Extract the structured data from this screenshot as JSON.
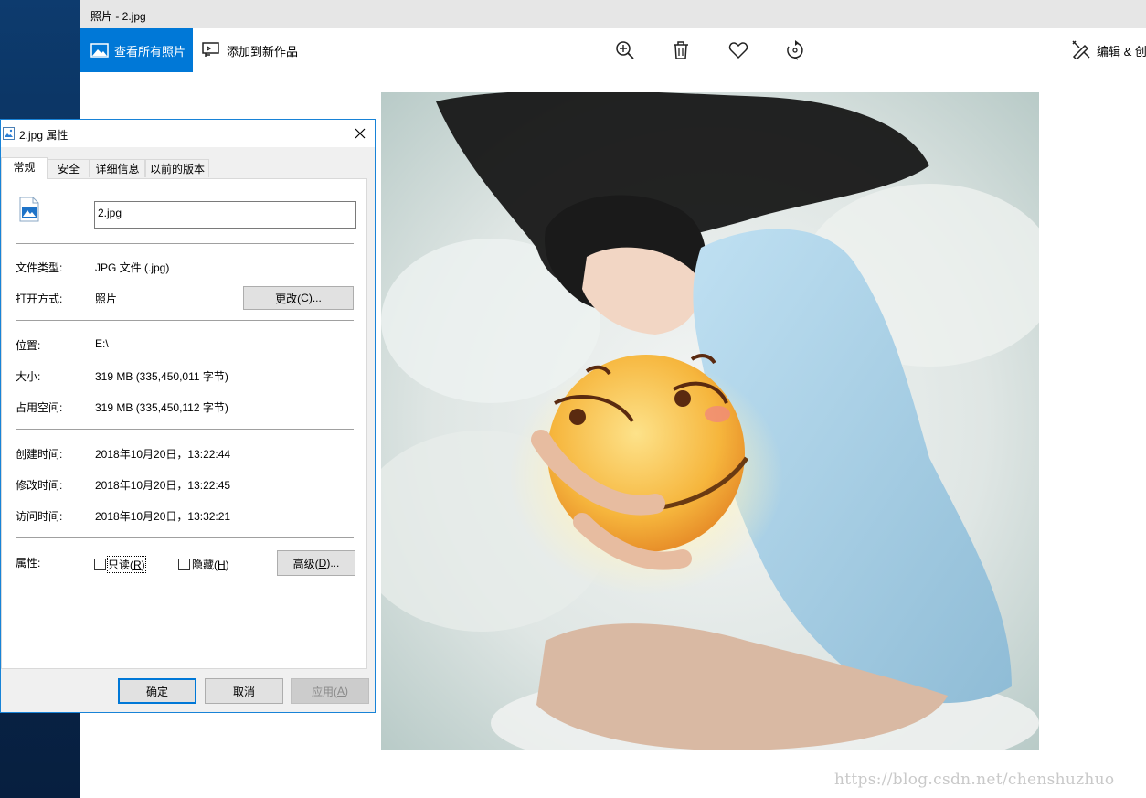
{
  "app": {
    "window_title": "照片 - 2.jpg",
    "toolbar": {
      "view_all_label": "查看所有照片",
      "add_to_creation_label": "添加到新作品",
      "edit_create_label": "编辑 & 创"
    },
    "watermark": "https://blog.csdn.net/chenshuzhuo"
  },
  "dialog": {
    "title": "2.jpg 属性",
    "tabs": [
      "常规",
      "安全",
      "详细信息",
      "以前的版本"
    ],
    "file_name": "2.jpg",
    "rows": {
      "file_type": {
        "label": "文件类型:",
        "value": "JPG 文件 (.jpg)"
      },
      "open_with": {
        "label": "打开方式:",
        "value": "照片"
      },
      "location": {
        "label": "位置:",
        "value": "E:\\"
      },
      "size": {
        "label": "大小:",
        "value": "319 MB (335,450,011 字节)"
      },
      "size_on_disk": {
        "label": "占用空间:",
        "value": "319 MB (335,450,112 字节)"
      },
      "created": {
        "label": "创建时间:",
        "value": "2018年10月20日，13:22:44"
      },
      "modified": {
        "label": "修改时间:",
        "value": "2018年10月20日，13:22:45"
      },
      "accessed": {
        "label": "访问时间:",
        "value": "2018年10月20日，13:32:21"
      },
      "attributes": {
        "label": "属性:"
      }
    },
    "change_button": {
      "text": "更改(",
      "key": "C",
      "tail": ")..."
    },
    "readonly": {
      "text": "只读(",
      "key": "R",
      "tail": ")",
      "checked": false
    },
    "hidden": {
      "text": "隐藏(",
      "key": "H",
      "tail": ")",
      "checked": false
    },
    "advanced_button": {
      "text": "高级(",
      "key": "D",
      "tail": ")..."
    },
    "ok_button": "确定",
    "cancel_button": "取消",
    "apply_button": {
      "text": "应用(",
      "key": "A",
      "tail": ")"
    }
  },
  "colors": {
    "accent": "#0078d7",
    "titlebar": "#e6e6e6",
    "dialog_bg": "#f0f0f0"
  }
}
